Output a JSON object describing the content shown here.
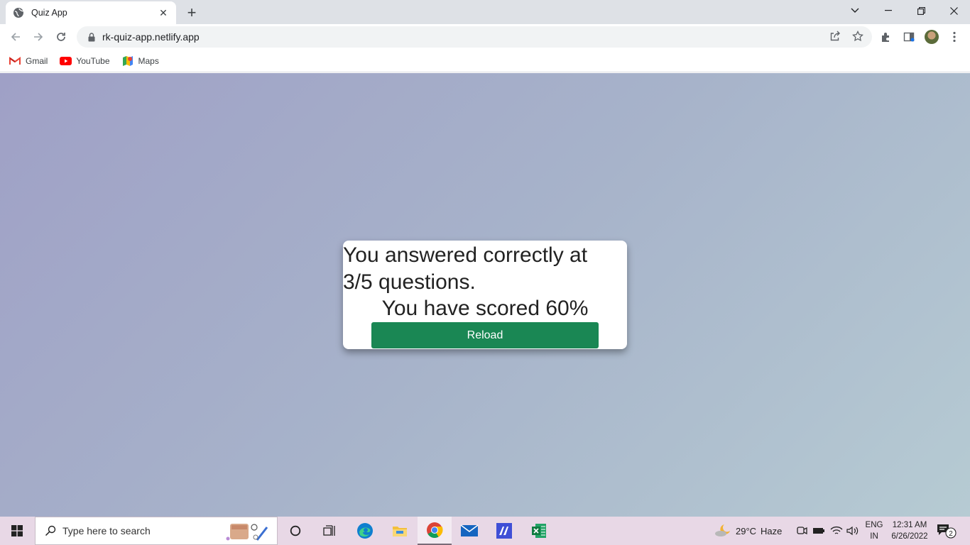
{
  "browser": {
    "tab_title": "Quiz App",
    "url": "rk-quiz-app.netlify.app",
    "bookmarks": [
      {
        "label": "Gmail",
        "icon": "gmail-icon"
      },
      {
        "label": "YouTube",
        "icon": "youtube-icon"
      },
      {
        "label": "Maps",
        "icon": "maps-icon"
      }
    ]
  },
  "quiz": {
    "result_text": "You answered correctly at 3/5 questions.",
    "score_text": "You have scored 60%",
    "reload_label": "Reload",
    "accent_color": "#1a8754"
  },
  "taskbar": {
    "search_placeholder": "Type here to search",
    "weather_temp": "29°C",
    "weather_desc": "Haze",
    "lang_line1": "ENG",
    "lang_line2": "IN",
    "time": "12:31 AM",
    "date": "6/26/2022",
    "notification_count": "2"
  }
}
